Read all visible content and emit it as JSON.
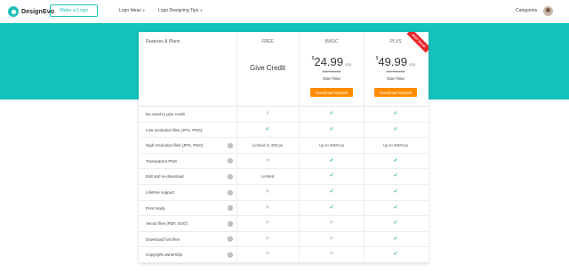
{
  "brand": {
    "name": "DesignEvo",
    "accent": "#16c2bd"
  },
  "nav": {
    "make_logo": "Make a Logo",
    "links": [
      {
        "label": "Logo Ideas",
        "chevron": "▾"
      },
      {
        "label": "Logo Designing Tips",
        "chevron": "▾"
      }
    ],
    "categories": "Categories",
    "categories_chevron": "▾"
  },
  "table": {
    "header_label": "Features & Plans",
    "plans": [
      {
        "name": "FREE",
        "headline": "Give Credit"
      },
      {
        "name": "BASIC",
        "currency": "$",
        "amount": "24.99",
        "unit": "USD",
        "old_price": "$39.99USD",
        "billing": "One-Time",
        "cta": "Download Sample"
      },
      {
        "name": "PLUS",
        "currency": "$",
        "amount": "49.99",
        "unit": "USD",
        "old_price": "$99.99USD",
        "billing": "One-Time",
        "cta": "Download Sample",
        "ribbon": "BEST VALUE"
      }
    ],
    "rows": [
      {
        "label": "No need to give credit",
        "info": false,
        "free": "✕",
        "basic": "✓",
        "plus": "✓"
      },
      {
        "label": "Low resolution files (JPG, PNG)",
        "info": false,
        "free": "✓",
        "basic": "✓",
        "plus": "✓"
      },
      {
        "label": "High resolution files (JPG, PNG)",
        "info": true,
        "free": "Limited to 300 px",
        "basic": "Up to 5000 px",
        "plus": "Up to 5000 px"
      },
      {
        "label": "Transparent PNG",
        "info": true,
        "free": "✕",
        "basic": "✓",
        "plus": "✓"
      },
      {
        "label": "Edit and re-download",
        "info": true,
        "free": "Limited",
        "basic": "✓",
        "plus": "✓"
      },
      {
        "label": "Lifetime support",
        "info": true,
        "free": "✕",
        "basic": "✓",
        "plus": "✓"
      },
      {
        "label": "Print ready",
        "info": true,
        "free": "✕",
        "basic": "✓",
        "plus": "✓"
      },
      {
        "label": "Vector files (PDF, SVG)",
        "info": true,
        "free": "✕",
        "basic": "✕",
        "plus": "✓"
      },
      {
        "label": "Download font files",
        "info": true,
        "free": "✕",
        "basic": "✕",
        "plus": "✓"
      },
      {
        "label": "Copyright ownership",
        "info": true,
        "free": "✕",
        "basic": "✕",
        "plus": "✓"
      }
    ],
    "info_glyph": "i"
  }
}
